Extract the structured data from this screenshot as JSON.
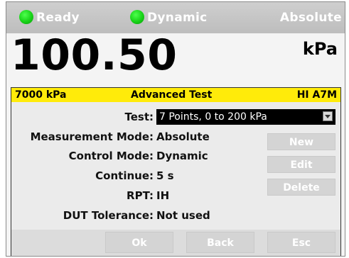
{
  "status": {
    "ready_label": "Ready",
    "dynamic_label": "Dynamic",
    "absolute_label": "Absolute",
    "led_color": "#17d217"
  },
  "reading": {
    "value": "100.50",
    "unit": "kPa"
  },
  "panel": {
    "header": {
      "range": "7000 kPa",
      "title": "Advanced Test",
      "module": "HI A7M"
    },
    "fields": {
      "test_label": "Test:",
      "test_value": "7 Points, 0 to 200 kPa",
      "measurement_mode_label": "Measurement Mode:",
      "measurement_mode_value": "Absolute",
      "control_mode_label": "Control Mode:",
      "control_mode_value": "Dynamic",
      "continue_label": "Continue:",
      "continue_value": "5 s",
      "rpt_label": "RPT:",
      "rpt_value": "IH",
      "dut_tolerance_label": "DUT Tolerance:",
      "dut_tolerance_value": "Not used"
    },
    "side_buttons": {
      "new": "New",
      "edit": "Edit",
      "delete": "Delete"
    },
    "bottom_buttons": {
      "ok": "Ok",
      "back": "Back",
      "esc": "Esc"
    }
  },
  "colors": {
    "header_yellow": "#ffeb0a",
    "status_bar": "#c6c6c6",
    "disabled_button": "#d4d4d4"
  }
}
